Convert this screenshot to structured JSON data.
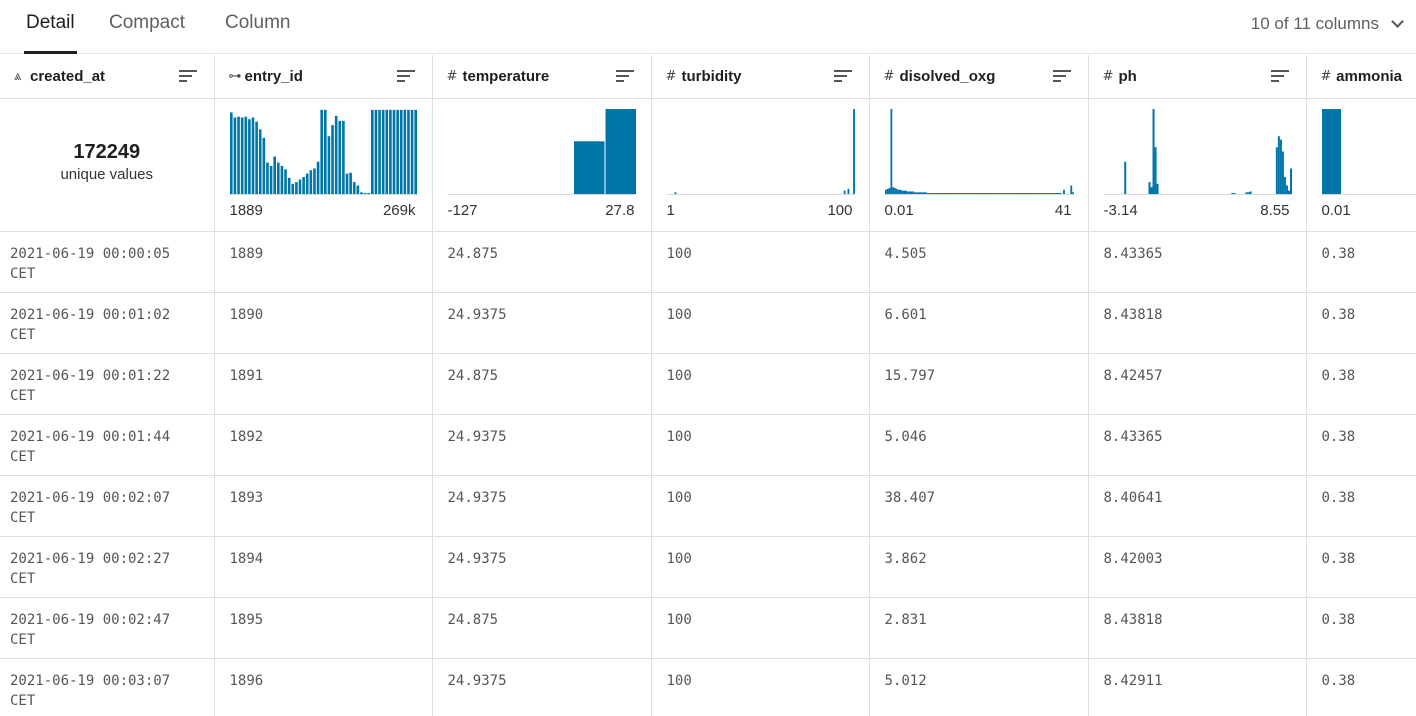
{
  "tabs": [
    {
      "label": "Detail",
      "active": true
    },
    {
      "label": "Compact",
      "active": false
    },
    {
      "label": "Column",
      "active": false
    }
  ],
  "columns_selector": {
    "label": "10 of 11 columns",
    "icon": "chevron-down-icon"
  },
  "columns": [
    {
      "name": "created_at",
      "type_icon": "⩓",
      "icon_name": "date-type-icon"
    },
    {
      "name": "entry_id",
      "type_icon": "⊶",
      "icon_name": "key-type-icon"
    },
    {
      "name": "temperature",
      "type_icon": "#",
      "icon_name": "number-type-icon"
    },
    {
      "name": "turbidity",
      "type_icon": "#",
      "icon_name": "number-type-icon"
    },
    {
      "name": "disolved_oxg",
      "type_icon": "#",
      "icon_name": "number-type-icon"
    },
    {
      "name": "ph",
      "type_icon": "#",
      "icon_name": "number-type-icon"
    },
    {
      "name": "ammonia",
      "type_icon": "#",
      "icon_name": "number-type-icon"
    }
  ],
  "summary": {
    "created_at": {
      "count": "172249",
      "label": "unique values"
    },
    "entry_id": {
      "min": "1889",
      "max": "269k",
      "bars": [
        0.96,
        0.9,
        0.91,
        0.9,
        0.91,
        0.88,
        0.9,
        0.85,
        0.76,
        0.66,
        0.37,
        0.33,
        0.44,
        0.37,
        0.33,
        0.29,
        0.19,
        0.12,
        0.14,
        0.17,
        0.2,
        0.24,
        0.28,
        0.3,
        0.38,
        0.99,
        0.99,
        0.68,
        0.81,
        0.92,
        0.86,
        0.86,
        0.24,
        0.25,
        0.14,
        0.1,
        0.02,
        0.01,
        0.01,
        0.99,
        0.99,
        0.99,
        0.99,
        0.99,
        0.99,
        0.99,
        0.99,
        0.99,
        0.99,
        0.99,
        0.99,
        0.99
      ]
    },
    "temperature": {
      "min": "-127",
      "max": "27.8",
      "bars": [
        0,
        0,
        0,
        0,
        0.62,
        1.0
      ]
    },
    "turbidity": {
      "min": "1",
      "max": "100",
      "bars": [
        0.0,
        0.0,
        0.0,
        0.0,
        0.02,
        0.0,
        0.0,
        0.0,
        0.0,
        0.0,
        0.0,
        0.0,
        0.0,
        0.0,
        0.0,
        0.0,
        0.0,
        0.0,
        0.0,
        0.0,
        0.0,
        0.0,
        0.0,
        0.0,
        0.0,
        0.0,
        0.0,
        0.0,
        0.0,
        0.0,
        0.0,
        0.0,
        0.0,
        0.0,
        0.0,
        0.0,
        0.0,
        0.0,
        0.0,
        0.0,
        0.0,
        0.0,
        0.0,
        0.0,
        0.0,
        0.0,
        0.0,
        0.0,
        0.0,
        0.0,
        0.0,
        0.0,
        0.0,
        0.0,
        0.0,
        0.0,
        0.0,
        0.0,
        0.0,
        0.0,
        0.0,
        0.0,
        0.0,
        0.0,
        0.0,
        0.0,
        0.0,
        0.0,
        0.0,
        0.0,
        0.0,
        0.0,
        0.0,
        0.0,
        0.0,
        0.0,
        0.0,
        0.0,
        0.0,
        0.0,
        0.0,
        0.0,
        0.0,
        0.0,
        0.0,
        0.0,
        0.0,
        0.0,
        0.0,
        0.0,
        0.0,
        0.0,
        0.0,
        0.0,
        0.04,
        0.0,
        0.06,
        0.0,
        0.0,
        1.0
      ]
    },
    "disolved_oxg": {
      "min": "0.01",
      "max": "41",
      "bars": [
        0.05,
        0.06,
        0.07,
        1.0,
        0.08,
        0.07,
        0.06,
        0.05,
        0.05,
        0.04,
        0.04,
        0.04,
        0.03,
        0.03,
        0.03,
        0.03,
        0.02,
        0.02,
        0.02,
        0.02,
        0.02,
        0.02,
        0.02,
        0.01,
        0.01,
        0.01,
        0.01,
        0.01,
        0.01,
        0.01,
        0.01,
        0.01,
        0.01,
        0.01,
        0.01,
        0.01,
        0.01,
        0.01,
        0.01,
        0.01,
        0.01,
        0.01,
        0.01,
        0.01,
        0.01,
        0.01,
        0.01,
        0.01,
        0.01,
        0.01,
        0.01,
        0.01,
        0.01,
        0.01,
        0.01,
        0.01,
        0.01,
        0.01,
        0.01,
        0.01,
        0.01,
        0.01,
        0.01,
        0.01,
        0.01,
        0.01,
        0.01,
        0.01,
        0.01,
        0.01,
        0.01,
        0.01,
        0.01,
        0.01,
        0.01,
        0.01,
        0.01,
        0.01,
        0.01,
        0.01,
        0.01,
        0.01,
        0.01,
        0.01,
        0.01,
        0.01,
        0.01,
        0.01,
        0.01,
        0.01,
        0.01,
        0.01,
        0.01,
        0.01,
        0.01,
        0.01,
        0.01,
        0.0,
        0.05,
        0.0,
        0.0,
        0.0,
        0.1,
        0.02
      ]
    },
    "ph": {
      "min": "-3.14",
      "max": "8.55",
      "bars": [
        0.0,
        0.0,
        0.0,
        0.0,
        0.0,
        0.0,
        0.0,
        0.0,
        0.0,
        0.0,
        0.38,
        0.0,
        0.0,
        0.0,
        0.0,
        0.0,
        0.0,
        0.0,
        0.0,
        0.0,
        0.0,
        0.0,
        0.14,
        0.08,
        1.0,
        0.55,
        0.12,
        0.0,
        0.0,
        0.0,
        0.0,
        0.0,
        0.0,
        0.0,
        0.0,
        0.0,
        0.0,
        0.0,
        0.0,
        0.0,
        0.0,
        0.0,
        0.0,
        0.0,
        0.0,
        0.0,
        0.0,
        0.0,
        0.0,
        0.0,
        0.0,
        0.0,
        0.0,
        0.0,
        0.0,
        0.0,
        0.0,
        0.0,
        0.0,
        0.0,
        0.0,
        0.0,
        0.0,
        0.01,
        0.01,
        0.0,
        0.0,
        0.0,
        0.0,
        0.0,
        0.02,
        0.02,
        0.03,
        0.0,
        0.0,
        0.0,
        0.0,
        0.0,
        0.0,
        0.0,
        0.0,
        0.0,
        0.0,
        0.0,
        0.0,
        0.55,
        0.68,
        0.64,
        0.5,
        0.2,
        0.1,
        0.04,
        0.3
      ]
    },
    "ammonia": {
      "min": "0.01",
      "max": "",
      "bars": [
        1.0
      ]
    }
  },
  "rows": [
    {
      "created_at": "2021-06-19 00:00:05",
      "tz": "CET",
      "entry_id": "1889",
      "temperature": "24.875",
      "turbidity": "100",
      "disolved_oxg": "4.505",
      "ph": "8.43365",
      "ammonia": "0.38"
    },
    {
      "created_at": "2021-06-19 00:01:02",
      "tz": "CET",
      "entry_id": "1890",
      "temperature": "24.9375",
      "turbidity": "100",
      "disolved_oxg": "6.601",
      "ph": "8.43818",
      "ammonia": "0.38"
    },
    {
      "created_at": "2021-06-19 00:01:22",
      "tz": "CET",
      "entry_id": "1891",
      "temperature": "24.875",
      "turbidity": "100",
      "disolved_oxg": "15.797",
      "ph": "8.42457",
      "ammonia": "0.38"
    },
    {
      "created_at": "2021-06-19 00:01:44",
      "tz": "CET",
      "entry_id": "1892",
      "temperature": "24.9375",
      "turbidity": "100",
      "disolved_oxg": "5.046",
      "ph": "8.43365",
      "ammonia": "0.38"
    },
    {
      "created_at": "2021-06-19 00:02:07",
      "tz": "CET",
      "entry_id": "1893",
      "temperature": "24.9375",
      "turbidity": "100",
      "disolved_oxg": "38.407",
      "ph": "8.40641",
      "ammonia": "0.38"
    },
    {
      "created_at": "2021-06-19 00:02:27",
      "tz": "CET",
      "entry_id": "1894",
      "temperature": "24.9375",
      "turbidity": "100",
      "disolved_oxg": "3.862",
      "ph": "8.42003",
      "ammonia": "0.38"
    },
    {
      "created_at": "2021-06-19 00:02:47",
      "tz": "CET",
      "entry_id": "1895",
      "temperature": "24.875",
      "turbidity": "100",
      "disolved_oxg": "2.831",
      "ph": "8.43818",
      "ammonia": "0.38"
    },
    {
      "created_at": "2021-06-19 00:03:07",
      "tz": "CET",
      "entry_id": "1896",
      "temperature": "24.9375",
      "turbidity": "100",
      "disolved_oxg": "5.012",
      "ph": "8.42911",
      "ammonia": "0.38"
    }
  ],
  "colors": {
    "bar": "#0076a8",
    "baseline": "#d8d8d8"
  }
}
